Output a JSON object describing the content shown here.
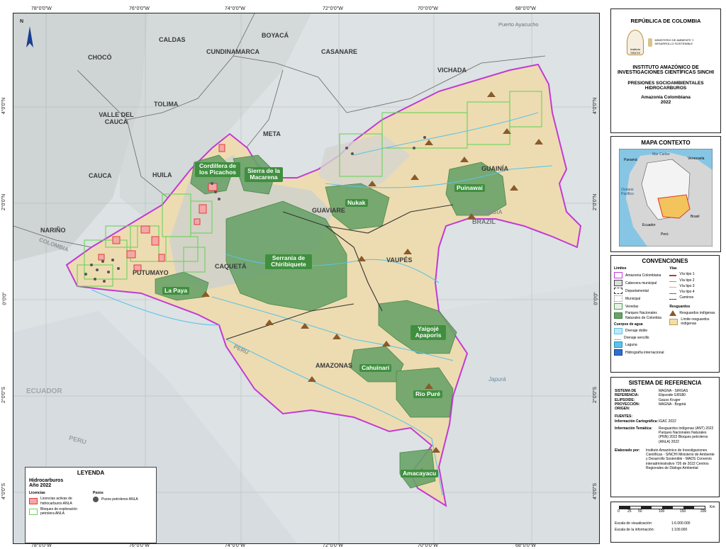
{
  "graticule": {
    "top": [
      "78°0'0\"W",
      "76°0'0\"W",
      "74°0'0\"W",
      "72°0'0\"W",
      "70°0'0\"W",
      "68°0'0\"W"
    ],
    "bottom": [
      "78°0'0\"W",
      "76°0'0\"W",
      "74°0'0\"W",
      "72°0'0\"W",
      "70°0'0\"W",
      "68°0'0\"W"
    ],
    "left": [
      "4°0'0\"N",
      "2°0'0\"N",
      "0°0'0\"",
      "2°0'0\"S",
      "4°0'0\"S"
    ],
    "right": [
      "4°0'0\"N",
      "2°0'0\"N",
      "0°0'0\"",
      "2°0'0\"S",
      "4°0'0\"S"
    ]
  },
  "north_arrow": "N",
  "places": {
    "choco": "CHOCÓ",
    "caldas": "CALDAS",
    "boyaca": "BOYACÁ",
    "cundinamarca": "CUNDINAMARCA",
    "casanare": "CASANARE",
    "tolima": "TOLIMA",
    "valle": "VALLE DEL CAUCA",
    "vichada": "VICHADA",
    "meta": "META",
    "cauca": "CAUCA",
    "huila": "HUILA",
    "guainia": "GUAINÍA",
    "narino": "NARIÑO",
    "guaviare": "GUAVIARE",
    "putumayo": "PUTUMAYO",
    "caqueta": "CAQUETÁ",
    "vaupes": "VAUPÉS",
    "amazonas": "AMAZONAS",
    "brazil": "BRAZIL",
    "colombia1": "COLOMBIA",
    "colombia2": "COLOMBIA",
    "peru": "PERU",
    "ecuador": "ECUADOR",
    "peru2": "PERU",
    "japura": "Japurá",
    "puerto_ayacucho": "Puerto Ayacucho"
  },
  "parks": {
    "picachos": "Cordillera de los Picachos",
    "macarena": "Sierra de la Macarena",
    "puinawai": "Puinawai",
    "nukak": "Nukak",
    "chiribiquete": "Serranía de Chiribiquete",
    "la_paya": "La Paya",
    "yaigoje": "Yaigojé Apaporis",
    "cahuinari": "Cahuinarí",
    "rio_pure": "Río Puré",
    "amacayacu": "Amacayacu"
  },
  "legend": {
    "title": "LEYENDA",
    "subtitle": "Hidrocarburos",
    "year": "Año 2022",
    "licencias_title": "Licencias",
    "pozos_title": "Pozos",
    "lic_activas": "Licencias activas de hidrocarburos ANLA",
    "bloques": "Bloques de exploración petrolera ANLA",
    "pozos": "Pozos petroleros ANLA"
  },
  "header": {
    "country": "REPÚBLICA DE COLOMBIA",
    "sinchi_logo": "Instituto SINCHI",
    "ministry_logo": "MINISTERIO DE AMBIENTE Y DESARROLLO SOSTENIBLE",
    "institute": "INSTITUTO AMAZÓNICO DE INVESTIGACIONES CIENTÍFICAS SINCHI",
    "map_title": "PRESIONES SOCIOAMBIENTALES HIDROCARBUROS",
    "region": "Amazonia Colombiana",
    "year": "2022"
  },
  "context_map": {
    "title": "MAPA CONTEXTO",
    "labels": [
      "Mar Caribe",
      "Venezuela",
      "Brasil",
      "Ecuador",
      "Perú",
      "Océano Pacífico",
      "Panamá"
    ]
  },
  "convenciones": {
    "title": "CONVENCIONES",
    "limites_title": "Límites",
    "limites": [
      "Amazonia Colombiana",
      "Cabecera municipal",
      "Departamental",
      "Municipal",
      "Veredas",
      "Parques Nacionales Naturales de Colombia"
    ],
    "vias_title": "Vías",
    "vias": [
      "Vía tipo 1",
      "Vía tipo 2",
      "Vía tipo 3",
      "Vía tipo 4",
      "Caminos"
    ],
    "agua_title": "Cuerpos de agua",
    "agua": [
      "Drenaje doble",
      "Drenaje sencillo",
      "Laguna",
      "Hidrografía internacional"
    ],
    "resguardos_title": "Resguardos",
    "resguardos": [
      "Resguardos indígenas",
      "Límite resguardos indígenas"
    ]
  },
  "colors": {
    "amazonia_boundary": "#c13ad6",
    "resguardo": "#f2dfa8",
    "park": "#5d9c5a",
    "license": "#e23b3b",
    "block": "#6bd35b",
    "water": "#5cc3e8"
  },
  "referencia": {
    "title": "SISTEMA DE REFERENCIA",
    "rows": [
      {
        "k": "SISTEMA DE REFERENCIA:",
        "v": "MAGNA - SIRGAS"
      },
      {
        "k": "ELIPSOIDE:",
        "v": "Elipsoide GRS80"
      },
      {
        "k": "PROYECCIÓN:",
        "v": "Gauss Kruger"
      },
      {
        "k": "ORIGEN:",
        "v": "MAGNA - Bogotá"
      }
    ],
    "fuentes_title": "FUENTES:",
    "info_carto_k": "Información Cartográfica:",
    "info_carto_v": "IGAC 2022",
    "info_tema_k": "Información Temática:",
    "info_tema_v": "Resguardos indígenas (ANT) 2022 Parques Nacionales Naturales (PNN) 2022 Bloques petroleros (ANLA) 2022",
    "elaborado_k": "Elaborado por:",
    "elaborado_v": "Instituto Amazónico de Investigaciones Científicas - SINCHI Ministerio de Ambiente y Desarrollo Sostenible - MADS Convenio interadministrativo 726 de 2022 Centros Regionales de Diálogo Ambiental"
  },
  "scale": {
    "ticks": [
      "0",
      "25",
      "50",
      "100",
      "150",
      "200"
    ],
    "unit": "Km",
    "vis_label": "Escala de visualización:",
    "vis_value": "1:6.000.000",
    "info_label": "Escala de la información:",
    "info_value": "1:100.000"
  }
}
